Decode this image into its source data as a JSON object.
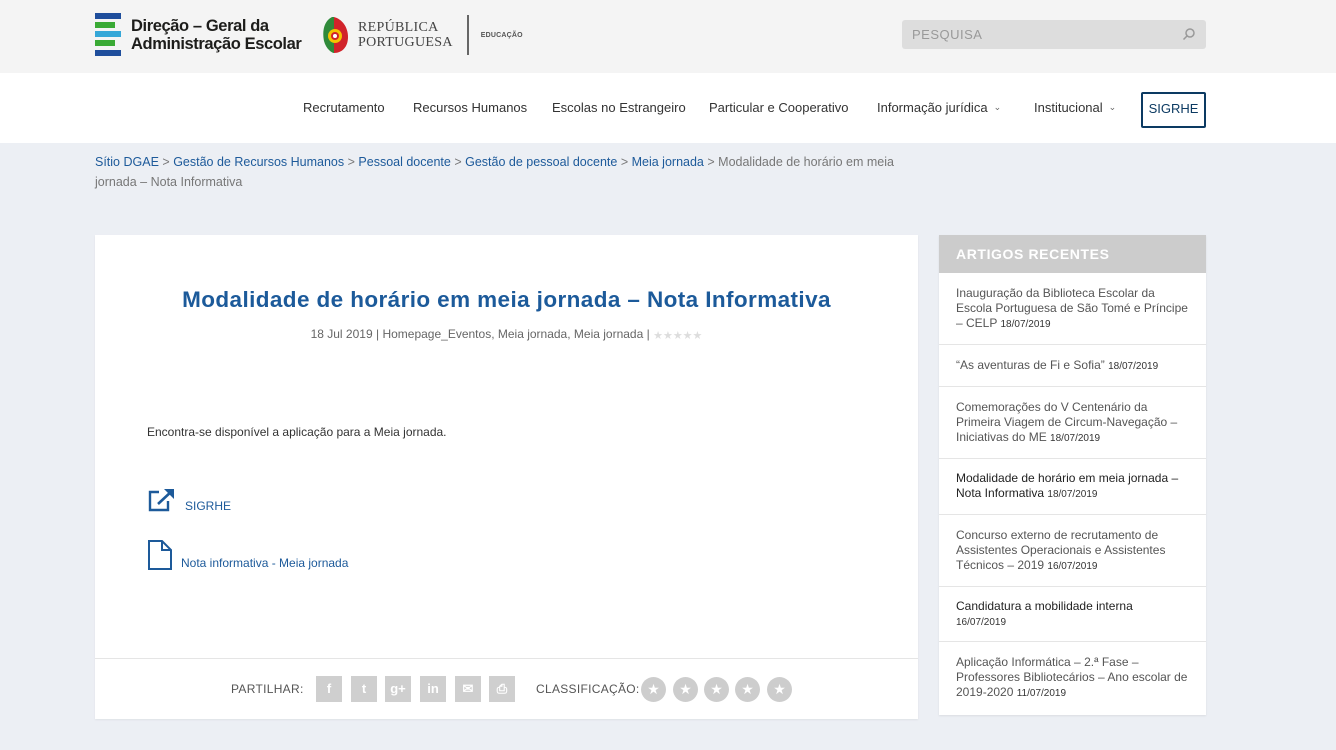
{
  "header": {
    "brand_line1": "Direção – Geral da",
    "brand_line2": "Administração Escolar",
    "rp_line1": "REPÚBLICA",
    "rp_line2": "PORTUGUESA",
    "rp_area": "EDUCAÇÃO",
    "search_placeholder": "PESQUISA",
    "colors": {
      "bar_green": "#3aaa35",
      "bar_blue": "#1f4e9c",
      "bar_light": "#35a7d8"
    }
  },
  "nav": {
    "items": [
      {
        "label": "Recrutamento"
      },
      {
        "label": "Recursos Humanos"
      },
      {
        "label": "Escolas no Estrangeiro"
      },
      {
        "label": "Particular e Cooperativo"
      },
      {
        "label": "Informação jurídica",
        "dropdown": true
      },
      {
        "label": "Institucional",
        "dropdown": true
      }
    ],
    "cta": "SIGRHE"
  },
  "breadcrumb": {
    "links": [
      "Sítio DGAE",
      "Gestão de Recursos Humanos",
      "Pessoal docente",
      "Gestão de pessoal docente",
      "Meia jornada"
    ],
    "separator": ">",
    "current": "Modalidade de horário em meia jornada – Nota Informativa"
  },
  "post": {
    "title": "Modalidade de horário em meia jornada – Nota Informativa",
    "date": "18 Jul 2019",
    "categories": "Homepage_Eventos, Meia jornada, Meia jornada",
    "meta_sep": "|",
    "meta_rating_stars": "★★★★★",
    "intro": "Encontra-se disponível a aplicação para a Meia jornada.",
    "links": [
      {
        "label": "SIGRHE",
        "icon": "external-link-icon"
      },
      {
        "label": "Nota informativa - Meia jornada",
        "icon": "document-icon"
      }
    ],
    "share_label": "PARTILHAR:",
    "share_buttons": [
      {
        "glyph": "f",
        "icon": "facebook-icon"
      },
      {
        "glyph": "t",
        "icon": "twitter-icon"
      },
      {
        "glyph": "g+",
        "icon": "google-plus-icon"
      },
      {
        "glyph": "in",
        "icon": "linkedin-icon"
      },
      {
        "glyph": "✉",
        "icon": "email-icon"
      },
      {
        "glyph": "⎙",
        "icon": "print-icon"
      }
    ],
    "rating_label": "CLASSIFICAÇÃO:",
    "rating_star": "★",
    "rating_count": 5,
    "accent_color": "#1c5a9a"
  },
  "sidebar": {
    "title": "ARTIGOS RECENTES",
    "articles": [
      {
        "title": "Inauguração da Biblioteca Escolar da Escola Portuguesa de São Tomé e Príncipe – CELP",
        "date": "18/07/2019"
      },
      {
        "title": "“As aventuras de Fi e Sofia”",
        "date": "18/07/2019"
      },
      {
        "title": "Comemorações do V Centenário da Primeira Viagem de Circum-Navegação – Iniciativas do ME",
        "date": "18/07/2019"
      },
      {
        "title": "Modalidade de horário em meia jornada – Nota Informativa",
        "date": "18/07/2019"
      },
      {
        "title": "Concurso externo de recrutamento de Assistentes Operacionais e Assistentes Técnicos – 2019",
        "date": "16/07/2019"
      },
      {
        "title": "Candidatura a mobilidade interna",
        "date": "16/07/2019"
      },
      {
        "title": "Aplicação Informática – 2.ª Fase – Professores Bibliotecários – Ano escolar de 2019-2020",
        "date": "11/07/2019"
      }
    ]
  }
}
